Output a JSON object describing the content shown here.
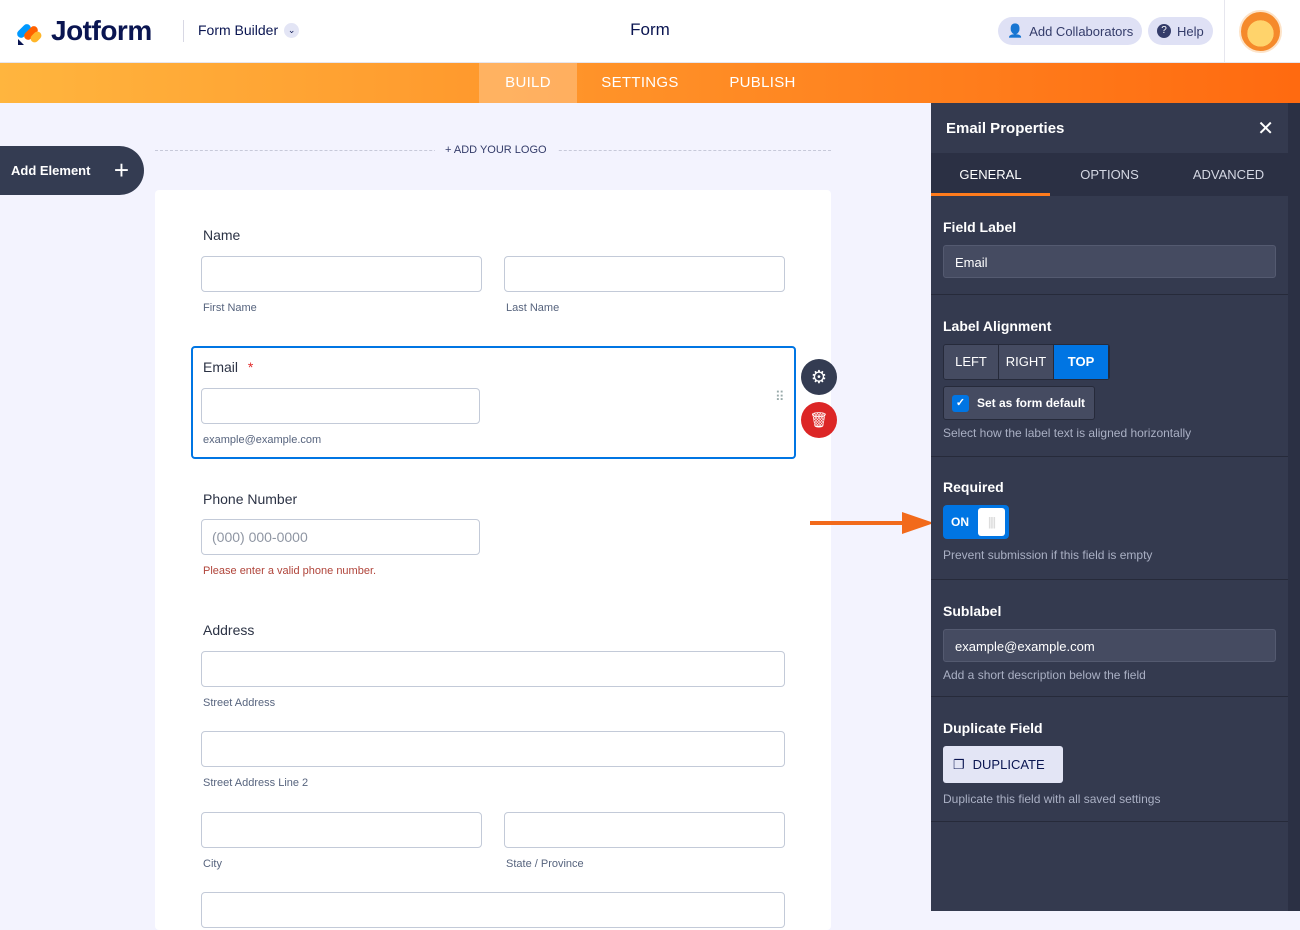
{
  "header": {
    "brand": "Jotform",
    "builder_label": "Form Builder",
    "title": "Form",
    "add_collaborators": "Add Collaborators",
    "help": "Help"
  },
  "nav": {
    "tabs": [
      "BUILD",
      "SETTINGS",
      "PUBLISH"
    ],
    "active": "BUILD"
  },
  "canvas": {
    "add_element": "Add Element",
    "add_logo": "+ ADD YOUR LOGO"
  },
  "form": {
    "name": {
      "label": "Name",
      "first": "First Name",
      "last": "Last Name"
    },
    "email": {
      "label": "Email",
      "required_mark": "*",
      "sublabel": "example@example.com"
    },
    "phone": {
      "label": "Phone Number",
      "placeholder": "(000) 000-0000",
      "sublabel": "Please enter a valid phone number."
    },
    "address": {
      "label": "Address",
      "street": "Street Address",
      "street2": "Street Address Line 2",
      "city": "City",
      "state": "State / Province"
    }
  },
  "panel": {
    "title": "Email Properties",
    "tabs": [
      "GENERAL",
      "OPTIONS",
      "ADVANCED"
    ],
    "field_label": {
      "heading": "Field Label",
      "value": "Email"
    },
    "alignment": {
      "heading": "Label Alignment",
      "options": [
        "LEFT",
        "RIGHT",
        "TOP"
      ],
      "selected": "TOP",
      "default_label": "Set as form default",
      "default_checked": true,
      "description": "Select how the label text is aligned horizontally"
    },
    "required": {
      "heading": "Required",
      "state": "ON",
      "description": "Prevent submission if this field is empty"
    },
    "sublabel": {
      "heading": "Sublabel",
      "value": "example@example.com",
      "description": "Add a short description below the field"
    },
    "duplicate": {
      "heading": "Duplicate Field",
      "button": "DUPLICATE",
      "description": "Duplicate this field with all saved settings"
    }
  },
  "colors": {
    "accent": "#0075e3",
    "orange": "#ff6a10",
    "panel": "#343a4f"
  }
}
